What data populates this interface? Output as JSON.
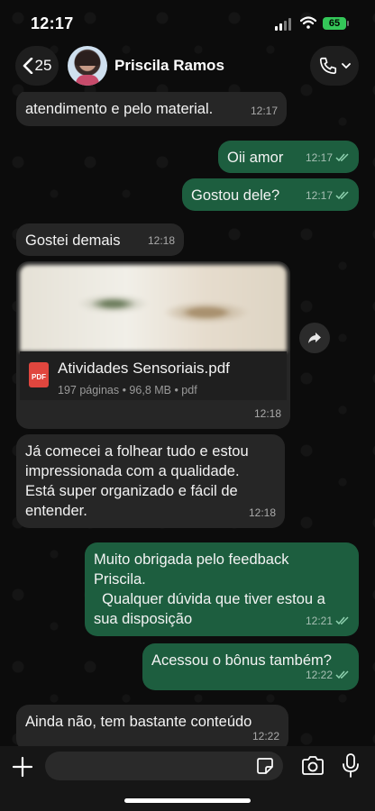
{
  "status_bar": {
    "time": "12:17",
    "battery": "65"
  },
  "header": {
    "back_count": "25",
    "contact_name": "Priscila Ramos"
  },
  "messages": [
    {
      "type": "in",
      "text": "atendimento e pelo material.",
      "time": "12:17"
    },
    {
      "type": "out",
      "text": "Oii amor",
      "time": "12:17"
    },
    {
      "type": "out",
      "text": "Gostou dele?",
      "time": "12:17"
    },
    {
      "type": "in",
      "text": "Gostei demais",
      "time": "12:18"
    },
    {
      "type": "doc",
      "file_name": "Atividades Sensoriais.pdf",
      "details": "197 páginas • 96,8 MB • pdf",
      "icon_label": "PDF",
      "time": "12:18"
    },
    {
      "type": "in",
      "text": "Já comecei a folhear tudo e estou\nimpressionada com a qualidade.\nEstá super organizado e fácil de\nentender.",
      "time": "12:18"
    },
    {
      "type": "out",
      "text": "Muito obrigada pelo feedback\nPriscila.\n  Qualquer dúvida que tiver estou a\nsua disposição",
      "time": "12:21"
    },
    {
      "type": "out",
      "text": "Acessou o bônus também?",
      "time": "12:22"
    },
    {
      "type": "in",
      "text": "Ainda não, tem bastante conteúdo",
      "time": "12:22"
    }
  ],
  "composer": {
    "placeholder": ""
  },
  "colors": {
    "incoming_bubble": "#262626",
    "outgoing_bubble": "#1d5e3f",
    "read_check": "#8fd1b0"
  }
}
